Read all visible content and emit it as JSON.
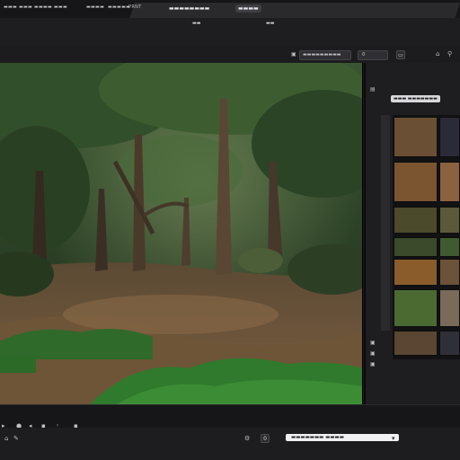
{
  "menubar": {
    "items": [
      "▬▬▬ ▬▬▬ ▬▬▬▬ ▬▬▬",
      "▬▬▬▬",
      "▬▬▬▬▬",
      "PRNT"
    ]
  },
  "tabs": [
    {
      "label": "▬▬▬▬▬▬▬▬",
      "active": false
    },
    {
      "label": "▬▬▬▬",
      "active": true
    }
  ],
  "toolbar": {
    "center_label": "▬▬",
    "right_label": "▬▬",
    "field_value": "▬▬▬▬▬▬▬▬▬",
    "value_field": "0"
  },
  "panel": {
    "header_chip": "▬▬▬ ▬▬▬▬▬▬▬"
  },
  "status": {
    "search_value": "▬▬▬▬▬▬▬ ▬▬▬▬"
  },
  "colors": {
    "background": "#1b1b1d",
    "viewport_canopy": "#2f4a2a",
    "viewport_ground": "#6b5139",
    "accent_input": "#f1f1f3"
  },
  "icons": [
    "play-icon",
    "record-icon",
    "home-icon",
    "gear-icon",
    "lock-icon",
    "dropdown-icon"
  ]
}
